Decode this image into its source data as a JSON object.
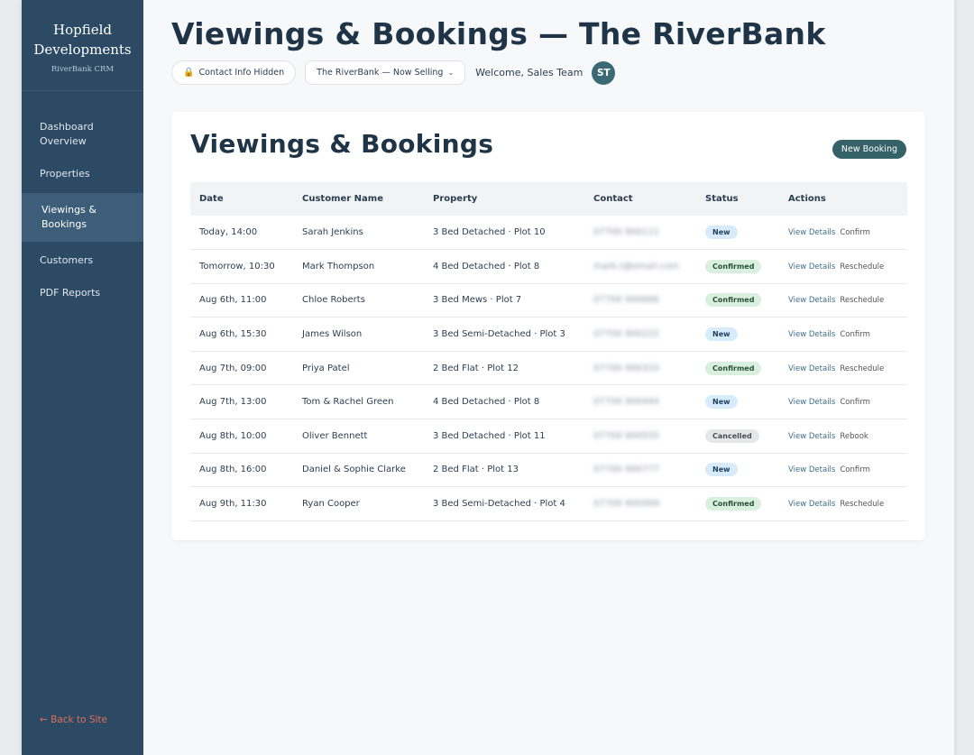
{
  "brand": {
    "line1": "Hopfield",
    "line2": "Developments",
    "subtitle": "RiverBank CRM"
  },
  "sidebar": {
    "items": [
      {
        "label": "Dashboard Overview",
        "active": false
      },
      {
        "label": "Properties",
        "active": false
      },
      {
        "label": "Viewings & Bookings",
        "active": true
      },
      {
        "label": "Customers",
        "active": false
      },
      {
        "label": "PDF Reports",
        "active": false
      }
    ],
    "back_link": "← Back to Site"
  },
  "header": {
    "title": "Viewings & Bookings — The RiverBank",
    "privacy_button": "Contact Info Hidden",
    "privacy_icon": "lock-icon",
    "development_select": "The RiverBank — Now Selling",
    "welcome": "Welcome, Sales Team",
    "avatar_initials": "ST"
  },
  "card": {
    "title": "Viewings & Bookings",
    "new_booking_button": "New Booking"
  },
  "table": {
    "columns": [
      "Date",
      "Customer Name",
      "Property",
      "Contact",
      "Status",
      "Actions"
    ],
    "rows": [
      {
        "date": "Today, 14:00",
        "customer": "Sarah Jenkins",
        "property": "3 Bed Detached · Plot 10",
        "contact": "07700 900111",
        "status": "New",
        "status_class": "new",
        "action1": "View Details",
        "action2": "Confirm"
      },
      {
        "date": "Tomorrow, 10:30",
        "customer": "Mark Thompson",
        "property": "4 Bed Detached · Plot 8",
        "contact": "mark.t@email.com",
        "status": "Confirmed",
        "status_class": "confirmed",
        "action1": "View Details",
        "action2": "Reschedule"
      },
      {
        "date": "Aug 6th, 11:00",
        "customer": "Chloe Roberts",
        "property": "3 Bed Mews · Plot 7",
        "contact": "07700 900666",
        "status": "Confirmed",
        "status_class": "confirmed",
        "action1": "View Details",
        "action2": "Reschedule"
      },
      {
        "date": "Aug 6th, 15:30",
        "customer": "James Wilson",
        "property": "3 Bed Semi-Detached · Plot 3",
        "contact": "07700 900222",
        "status": "New",
        "status_class": "new",
        "action1": "View Details",
        "action2": "Confirm"
      },
      {
        "date": "Aug 7th, 09:00",
        "customer": "Priya Patel",
        "property": "2 Bed Flat · Plot 12",
        "contact": "07700 900333",
        "status": "Confirmed",
        "status_class": "confirmed",
        "action1": "View Details",
        "action2": "Reschedule"
      },
      {
        "date": "Aug 7th, 13:00",
        "customer": "Tom & Rachel Green",
        "property": "4 Bed Detached · Plot 8",
        "contact": "07700 900444",
        "status": "New",
        "status_class": "new",
        "action1": "View Details",
        "action2": "Confirm"
      },
      {
        "date": "Aug 8th, 10:00",
        "customer": "Oliver Bennett",
        "property": "3 Bed Detached · Plot 11",
        "contact": "07700 900555",
        "status": "Cancelled",
        "status_class": "cancelled",
        "action1": "View Details",
        "action2": "Rebook"
      },
      {
        "date": "Aug 8th, 16:00",
        "customer": "Daniel & Sophie Clarke",
        "property": "2 Bed Flat · Plot 13",
        "contact": "07700 900777",
        "status": "New",
        "status_class": "new",
        "action1": "View Details",
        "action2": "Confirm"
      },
      {
        "date": "Aug 9th, 11:30",
        "customer": "Ryan Cooper",
        "property": "3 Bed Semi-Detached · Plot 4",
        "contact": "07700 900999",
        "status": "Confirmed",
        "status_class": "confirmed",
        "action1": "View Details",
        "action2": "Reschedule"
      }
    ]
  },
  "colors": {
    "sidebar_bg": "#2c4a63",
    "accent_button": "#356267",
    "back_link": "#e06c5a",
    "badge_new": "#d7ebfa",
    "badge_confirmed": "#d9efdf",
    "badge_cancelled": "#e5e7e9"
  }
}
